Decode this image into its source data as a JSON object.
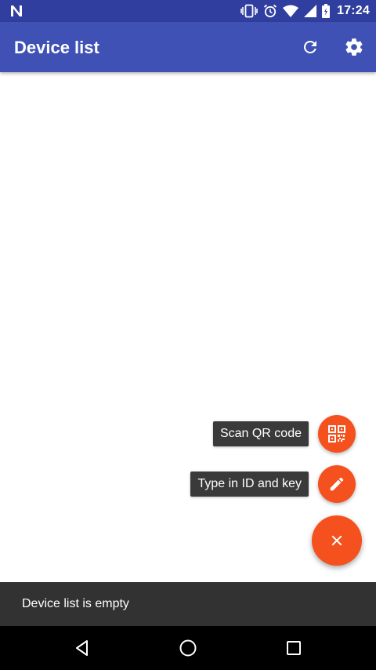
{
  "status_bar": {
    "time": "17:24",
    "icons": [
      "n-logo-icon",
      "vibrate-icon",
      "alarm-icon",
      "wifi-icon",
      "signal-icon",
      "battery-icon"
    ]
  },
  "app_bar": {
    "title": "Device list",
    "actions": [
      {
        "name": "refresh",
        "icon": "refresh-icon"
      },
      {
        "name": "settings",
        "icon": "gear-icon"
      }
    ]
  },
  "speed_dial": {
    "items": [
      {
        "label": "Scan QR code",
        "icon": "qr-code-icon"
      },
      {
        "label": "Type in ID and key",
        "icon": "pencil-icon"
      }
    ],
    "main_icon": "close-icon"
  },
  "snackbar": {
    "text": "Device list is empty"
  },
  "nav_bar": {
    "buttons": [
      "back-icon",
      "home-icon",
      "recents-icon"
    ]
  },
  "colors": {
    "status_bar": "#303f9f",
    "app_bar": "#3f51b5",
    "accent": "#f4511e",
    "snackbar": "#323232",
    "label_bg": "#3a3a3a"
  }
}
